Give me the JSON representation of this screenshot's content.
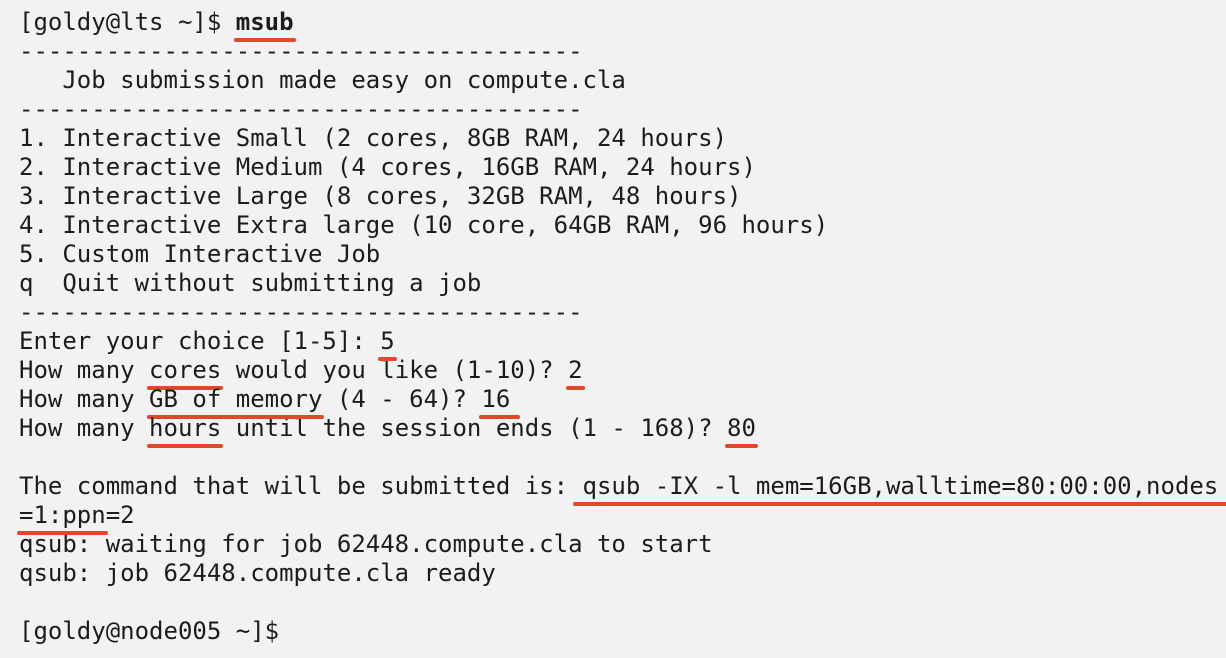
{
  "terminal": {
    "prompt1": "[goldy@lts ~]$ ",
    "command1": "msub",
    "separator": "---------------------------------------",
    "banner": "   Job submission made easy on compute.cla",
    "menu": [
      "1. Interactive Small (2 cores, 8GB RAM, 24 hours)",
      "2. Interactive Medium (4 cores, 16GB RAM, 24 hours)",
      "3. Interactive Large (8 cores, 32GB RAM, 48 hours)",
      "4. Interactive Extra large (10 core, 64GB RAM, 96 hours)",
      "5. Custom Interactive Job",
      "q  Quit without submitting a job"
    ],
    "choice_prompt": "Enter your choice [1-5]: ",
    "choice_value": "5",
    "cores_prefix": "How many ",
    "cores_word": "cores",
    "cores_suffix": " would you like (1-10)? ",
    "cores_value": "2",
    "mem_prefix": "How many ",
    "mem_word": "GB of memory",
    "mem_suffix": " (4 - 64)? ",
    "mem_value": "16",
    "hours_prefix": "How many ",
    "hours_word": "hours",
    "hours_suffix": " until the session ends (1 - 168)? ",
    "hours_value": "80",
    "command_prefix": "The command that will be submitted is: ",
    "command_part1": "qsub -IX -l mem=16GB,walltime=80:00:00,nodes",
    "command_part2": "=1:ppn",
    "command_part3": "=2",
    "wait_line": "qsub: waiting for job 62448.compute.cla to start",
    "ready_line": "qsub: job 62448.compute.cla ready",
    "prompt2": "[goldy@node005 ~]$ "
  },
  "colors": {
    "background": "#f2f2f2",
    "text": "#1c1c1c",
    "highlight": "#e0472b"
  }
}
